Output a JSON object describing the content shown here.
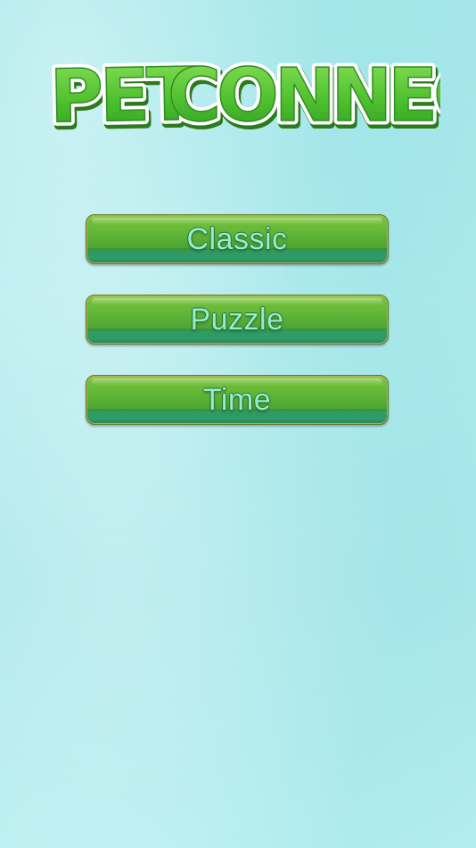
{
  "logo": {
    "word1": "PET",
    "word2": "CONNECT",
    "fill_color": "#4fc02f",
    "outline_color": "#ffffff",
    "shadow_color": "#2d7a1c"
  },
  "menu": {
    "items": [
      {
        "label": "Classic"
      },
      {
        "label": "Puzzle"
      },
      {
        "label": "Time"
      }
    ],
    "text_color": "#8ff0c9",
    "button_color": "#5cb236"
  }
}
